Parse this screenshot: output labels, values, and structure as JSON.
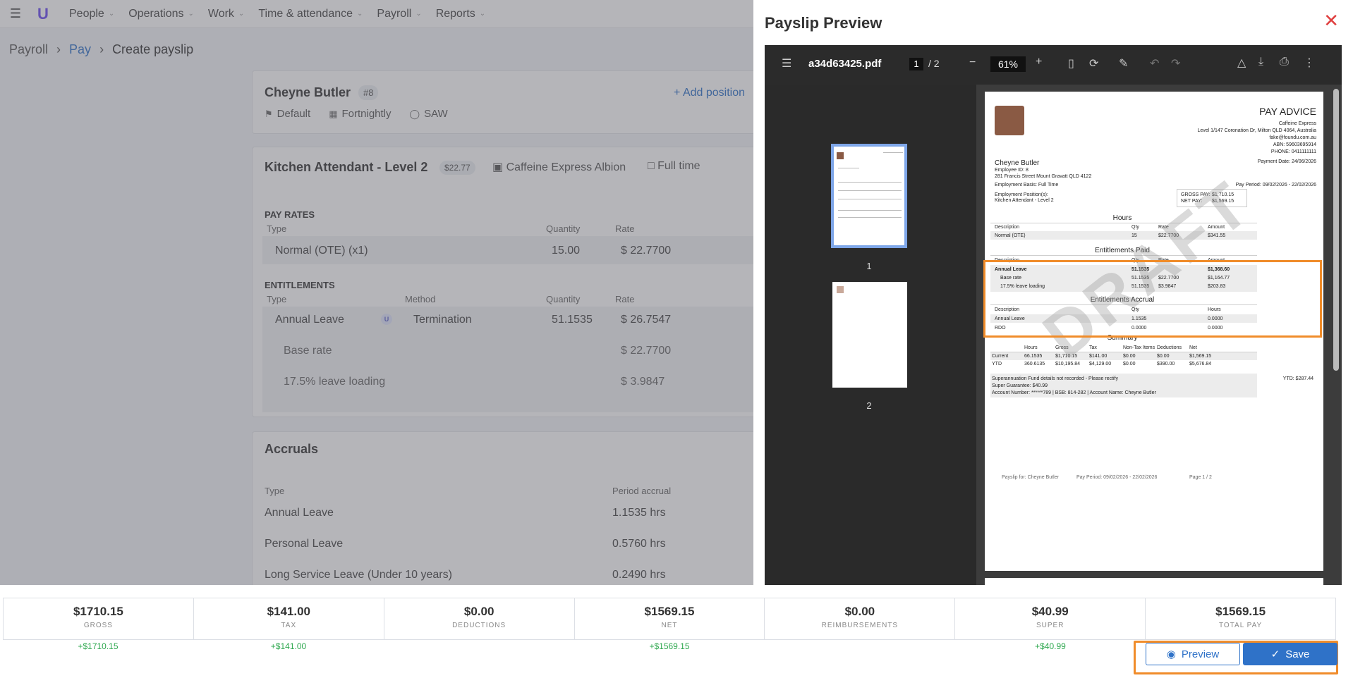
{
  "nav": {
    "items": [
      "People",
      "Operations",
      "Work",
      "Time & attendance",
      "Payroll",
      "Reports"
    ]
  },
  "breadcrumb": {
    "root": "Payroll",
    "mid": "Pay",
    "current": "Create payslip"
  },
  "employee": {
    "name": "Cheyne Butler",
    "number": "#8",
    "template": "Default",
    "frequency": "Fortnightly",
    "award": "SAW",
    "add_position": "Add position"
  },
  "position": {
    "title": "Kitchen Attendant - Level 2",
    "rate": "$22.77",
    "location": "Caffeine Express Albion",
    "type": "Full time",
    "pay_rates_label": "PAY RATES",
    "pay_rates_headers": {
      "type": "Type",
      "qty": "Quantity",
      "rate": "Rate"
    },
    "pay_rate_row": {
      "type": "Normal (OTE) (x1)",
      "qty": "15.00",
      "rate": "$ 22.7700"
    },
    "entitlements_label": "ENTITLEMENTS",
    "ent_headers": {
      "type": "Type",
      "method": "Method",
      "qty": "Quantity",
      "rate": "Rate"
    },
    "ent_row": {
      "type": "Annual Leave",
      "badge": "U",
      "method": "Termination",
      "qty": "51.1535",
      "rate": "$ 26.7547"
    },
    "ent_sub": [
      {
        "label": "Base rate",
        "rate": "$ 22.7700"
      },
      {
        "label": "17.5% leave loading",
        "rate": "$ 3.9847"
      }
    ]
  },
  "accruals": {
    "title": "Accruals",
    "headers": {
      "type": "Type",
      "period": "Period accrual"
    },
    "rows": [
      {
        "type": "Annual Leave",
        "period": "1.1535 hrs"
      },
      {
        "type": "Personal Leave",
        "period": "0.5760 hrs"
      },
      {
        "type": "Long Service Leave (Under 10 years)",
        "period": "0.2490 hrs"
      }
    ]
  },
  "totals": [
    {
      "value": "$1710.15",
      "label": "GROSS",
      "delta": "+$1710.15"
    },
    {
      "value": "$141.00",
      "label": "TAX",
      "delta": "+$141.00"
    },
    {
      "value": "$0.00",
      "label": "DEDUCTIONS",
      "delta": ""
    },
    {
      "value": "$1569.15",
      "label": "NET",
      "delta": "+$1569.15"
    },
    {
      "value": "$0.00",
      "label": "REIMBURSEMENTS",
      "delta": ""
    },
    {
      "value": "$40.99",
      "label": "SUPER",
      "delta": "+$40.99"
    },
    {
      "value": "$1569.15",
      "label": "TOTAL PAY",
      "delta": ""
    }
  ],
  "buttons": {
    "preview": "Preview",
    "save": "Save"
  },
  "modal": {
    "title": "Payslip Preview",
    "viewer": {
      "filename": "a34d63425.pdf",
      "page": "1",
      "pages": "2",
      "zoom": "61%",
      "thumb1": "1",
      "thumb2": "2"
    }
  },
  "pdf": {
    "heading": "PAY ADVICE",
    "company": [
      "Caffeine Express",
      "Level 1/147 Coronation Dr, Milton QLD 4064, Australia",
      "fake@foundu.com.au",
      "ABN: 59603695914",
      "PHONE: 0411111111"
    ],
    "payment_date": "Payment Date: 24/06/2026",
    "emp_name": "Cheyne Butler",
    "emp_id": "Employee ID: 8",
    "emp_addr": "281 Francis Street Mount Gravatt QLD 4122",
    "basis": "Employment Basis: Full Time",
    "period": "Pay Period: 09/02/2026 - 22/02/2026",
    "positions_label": "Employment Position(s):",
    "positions_value": "Kitchen Attendant - Level 2",
    "gross_label": "GROSS PAY:",
    "gross_value": "$1,710.15",
    "net_label": "NET PAY:",
    "net_value": "$1,569.15",
    "hours_title": "Hours",
    "hours_headers": [
      "Description",
      "Qty",
      "Rate",
      "Amount"
    ],
    "hours_row": [
      "Normal (OTE)",
      "15",
      "$22.7700",
      "$341.55"
    ],
    "ent_title": "Entitlements Paid",
    "ent_headers": [
      "Description",
      "Qty",
      "Rate",
      "Amount"
    ],
    "ent_rows": [
      [
        "Annual Leave",
        "51.1535",
        "",
        "$1,368.60"
      ],
      [
        "Base rate",
        "51.1535",
        "$22.7700",
        "$1,164.77"
      ],
      [
        "17.5% leave loading",
        "51.1535",
        "$3.9847",
        "$203.83"
      ]
    ],
    "accr_title": "Entitlements Accrual",
    "accr_headers": [
      "Description",
      "Qty",
      "Hours"
    ],
    "accr_rows": [
      [
        "Annual Leave",
        "1.1535",
        "0.0000"
      ],
      [
        "RDO",
        "0.0000",
        "0.0000"
      ]
    ],
    "sum_title": "Summary",
    "sum_headers": [
      "Hours",
      "Gross",
      "Tax",
      "Non-Tax Items",
      "Deductions",
      "Net"
    ],
    "sum_rows": [
      [
        "Current",
        "66.1535",
        "$1,710.15",
        "$141.00",
        "$0.00",
        "$0.00",
        "$1,569.15"
      ],
      [
        "YTD",
        "360.6135",
        "$10,195.84",
        "$4,129.00",
        "$0.00",
        "$390.00",
        "$5,676.84"
      ]
    ],
    "super_note": "Superannuation Fund details not recorded - Please rectify",
    "super_ytd": "YTD: $287.44",
    "super_guarantee": "Super Guarantee: $40.99",
    "account": "Account Number: ******789 | BSB: 814-282 | Account Name: Cheyne Butler",
    "footer_left": "Payslip for: Cheyne Butler",
    "footer_mid": "Pay Period: 09/02/2026 - 22/02/2026",
    "footer_right": "Page 1 / 2",
    "watermark": "DRAFT"
  }
}
